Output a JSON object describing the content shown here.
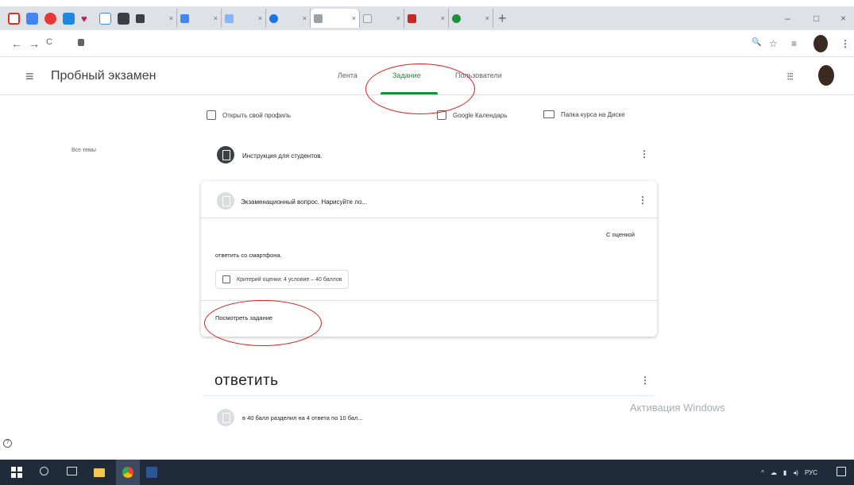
{
  "browser": {
    "tab_icons": [
      {
        "icon": "gmail-icon",
        "color": "#d93025"
      },
      {
        "icon": "app-blue-icon",
        "color": "#4285f4"
      },
      {
        "icon": "app-red-icon",
        "color": "#e53935"
      },
      {
        "icon": "app-bluebird-icon",
        "color": "#1e88e5"
      },
      {
        "icon": "heart-icon",
        "color": "#c2185b"
      },
      {
        "icon": "search-icon",
        "color": "#4285f4"
      },
      {
        "icon": "book-icon",
        "color": "#3c4043"
      }
    ],
    "tabs": [
      {
        "color": "#3c4043",
        "active": false
      },
      {
        "color": "#4285f4",
        "active": false
      },
      {
        "color": "#8ab4f8",
        "active": false
      },
      {
        "color": "#1a73e8",
        "active": false
      },
      {
        "color": "#9aa0a6",
        "active": true
      },
      {
        "color": "#e8eaed",
        "active": false
      },
      {
        "color": "#c62828",
        "active": false
      },
      {
        "color": "#1e8e3e",
        "active": false
      }
    ],
    "new_tab_label": "+",
    "window_controls": [
      "–",
      "□",
      "×"
    ],
    "back": "←",
    "forward": "→",
    "reload": "C",
    "address": "",
    "omnibox_actions": [
      "🔍",
      "☆",
      "≡"
    ]
  },
  "app": {
    "menu_icon": "≡",
    "class_name": "Пробный экзамен",
    "tabs": [
      "Лента",
      "Задание",
      "Пользователи"
    ],
    "active_tab": 1,
    "apps_icon": "⋮⋮⋮",
    "accent": "#1e8e3e"
  },
  "links": {
    "profile": "Открыть свой профиль",
    "calendar": "Google Календарь",
    "drive_folder": "Папка курса на Диске"
  },
  "sidebar": {
    "items": [
      "Все темы",
      "",
      ""
    ]
  },
  "assignments": [
    {
      "title": "Инструкция для студентов.",
      "meta": "",
      "icon": "assignment-icon-dark"
    },
    {
      "title": "Экзаменационный вопрос. Нарисуйте ло...",
      "meta": "",
      "icon": "assignment-icon-grey"
    }
  ],
  "expanded": {
    "published": "",
    "grading": "С оценкой",
    "description": "ответить со смартфона.",
    "rubric_chip": "Критерий оценки: 4 условие – 40 баллов",
    "view_link": "Посмотреть задание"
  },
  "topic": {
    "title": "ответить",
    "items": [
      {
        "title": "в 40 балл разделил на 4 ответа по 10 бал...",
        "meta": ""
      }
    ]
  },
  "help_icon": "?",
  "watermark": {
    "title": "Активация Windows",
    "subtitle": ""
  },
  "taskbar": {
    "tray_lang": "РУС",
    "time": "",
    "date": ""
  },
  "annotations": {
    "ring_color": "#d52020"
  }
}
